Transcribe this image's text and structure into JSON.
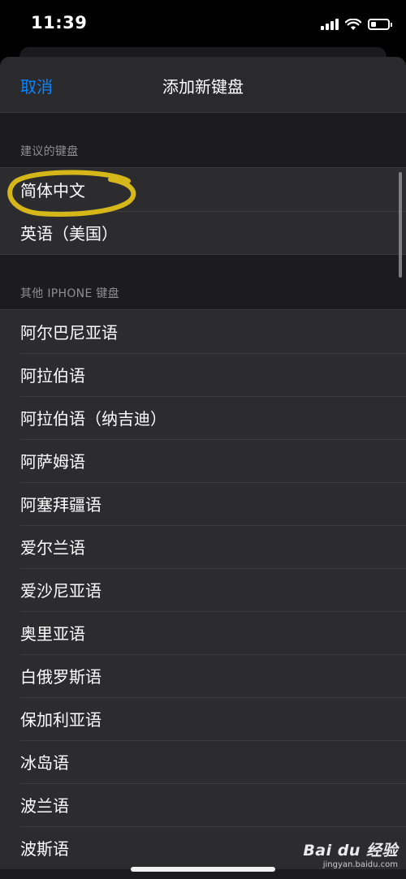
{
  "status_bar": {
    "time": "11:39",
    "icons": [
      "cellular-signal-icon",
      "wifi-icon",
      "battery-icon"
    ]
  },
  "nav": {
    "cancel_label": "取消",
    "title": "添加新键盘"
  },
  "suggested": {
    "header": "建议的键盘",
    "items": [
      "简体中文",
      "英语（美国）"
    ]
  },
  "other": {
    "header": "其他 IPHONE 键盘",
    "items": [
      "阿尔巴尼亚语",
      "阿拉伯语",
      "阿拉伯语（纳吉迪）",
      "阿萨姆语",
      "阿塞拜疆语",
      "爱尔兰语",
      "爱沙尼亚语",
      "奥里亚语",
      "白俄罗斯语",
      "保加利亚语",
      "冰岛语",
      "波兰语",
      "波斯语"
    ]
  },
  "watermark": {
    "main": "Bai du 经验",
    "sub": "jingyan.baidu.com"
  },
  "colors": {
    "accent": "#0a84ff",
    "highlight_marker": "#e5c319",
    "sheet_background": "#1c1c1e",
    "row_background": "#2c2c2e"
  }
}
